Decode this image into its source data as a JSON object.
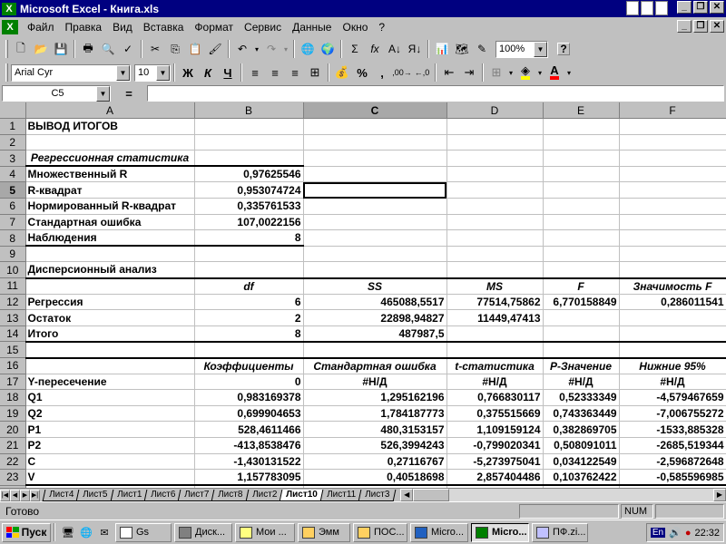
{
  "window": {
    "app_title": "Microsoft Excel - Книга.xls"
  },
  "menu": [
    "Файл",
    "Правка",
    "Вид",
    "Вставка",
    "Формат",
    "Сервис",
    "Данные",
    "Окно",
    "?"
  ],
  "toolbar": {
    "zoom": "100%",
    "font": "Arial Cyr",
    "font_size": "10",
    "bold": "Ж",
    "italic": "К",
    "underline": "Ч",
    "percent": "%",
    "comma": ",",
    "sum": "Σ",
    "fx": "fx",
    "help": "?"
  },
  "formula_bar": {
    "name_box": "C5",
    "equals": "=",
    "content": ""
  },
  "columns": [
    "A",
    "B",
    "C",
    "D",
    "E",
    "F"
  ],
  "rows": [
    {
      "n": "1",
      "a": "ВЫВОД ИТОГОВ",
      "b": "",
      "c": "",
      "d": "",
      "e": "",
      "f": ""
    },
    {
      "n": "2",
      "a": "",
      "b": "",
      "c": "",
      "d": "",
      "e": "",
      "f": ""
    },
    {
      "n": "3",
      "a": "Регрессионная статистика",
      "b": "",
      "c": "",
      "d": "",
      "e": "",
      "f": ""
    },
    {
      "n": "4",
      "a": "Множественный R",
      "b": "0,97625546",
      "c": "",
      "d": "",
      "e": "",
      "f": ""
    },
    {
      "n": "5",
      "a": "R-квадрат",
      "b": "0,953074724",
      "c": "",
      "d": "",
      "e": "",
      "f": ""
    },
    {
      "n": "6",
      "a": "Нормированный R-квадрат",
      "b": "0,335761533",
      "c": "",
      "d": "",
      "e": "",
      "f": ""
    },
    {
      "n": "7",
      "a": "Стандартная ошибка",
      "b": "107,0022156",
      "c": "",
      "d": "",
      "e": "",
      "f": ""
    },
    {
      "n": "8",
      "a": "Наблюдения",
      "b": "8",
      "c": "",
      "d": "",
      "e": "",
      "f": ""
    },
    {
      "n": "9",
      "a": "",
      "b": "",
      "c": "",
      "d": "",
      "e": "",
      "f": ""
    },
    {
      "n": "10",
      "a": "Дисперсионный анализ",
      "b": "",
      "c": "",
      "d": "",
      "e": "",
      "f": ""
    },
    {
      "n": "11",
      "a": "",
      "b": "df",
      "c": "SS",
      "d": "MS",
      "e": "F",
      "f": "Значимость F"
    },
    {
      "n": "12",
      "a": "Регрессия",
      "b": "6",
      "c": "465088,5517",
      "d": "77514,75862",
      "e": "6,770158849",
      "f": "0,286011541"
    },
    {
      "n": "13",
      "a": "Остаток",
      "b": "2",
      "c": "22898,94827",
      "d": "11449,47413",
      "e": "",
      "f": ""
    },
    {
      "n": "14",
      "a": "Итого",
      "b": "8",
      "c": "487987,5",
      "d": "",
      "e": "",
      "f": ""
    },
    {
      "n": "15",
      "a": "",
      "b": "",
      "c": "",
      "d": "",
      "e": "",
      "f": ""
    },
    {
      "n": "16",
      "a": "",
      "b": "Коэффициенты",
      "c": "Стандартная ошибка",
      "d": "t-статистика",
      "e": "P-Значение",
      "f": "Нижние 95%"
    },
    {
      "n": "17",
      "a": "Y-пересечение",
      "b": "0",
      "c": "#Н/Д",
      "d": "#Н/Д",
      "e": "#Н/Д",
      "f": "#Н/Д"
    },
    {
      "n": "18",
      "a": "Q1",
      "b": "0,983169378",
      "c": "1,295162196",
      "d": "0,766830117",
      "e": "0,52333349",
      "f": "-4,579467659"
    },
    {
      "n": "19",
      "a": "Q2",
      "b": "0,699904653",
      "c": "1,784187773",
      "d": "0,375515669",
      "e": "0,743363449",
      "f": "-7,006755272"
    },
    {
      "n": "20",
      "a": "P1",
      "b": "528,4611466",
      "c": "480,3153157",
      "d": "1,109159124",
      "e": "0,382869705",
      "f": "-1533,885328"
    },
    {
      "n": "21",
      "a": "P2",
      "b": "-413,8538476",
      "c": "526,3994243",
      "d": "-0,799020341",
      "e": "0,508091011",
      "f": "-2685,519344"
    },
    {
      "n": "22",
      "a": "C",
      "b": "-1,430131522",
      "c": "0,27116767",
      "d": "-5,273975041",
      "e": "0,034122549",
      "f": "-2,596872648"
    },
    {
      "n": "23",
      "a": "V",
      "b": "1,157783095",
      "c": "0,40518698",
      "d": "2,857404486",
      "e": "0,103762422",
      "f": "-0,585596985"
    },
    {
      "n": "24",
      "a": "",
      "b": "",
      "c": "",
      "d": "",
      "e": "",
      "f": ""
    }
  ],
  "sheet_tabs": [
    "Лист4",
    "Лист5",
    "Лист1",
    "Лист6",
    "Лист7",
    "Лист8",
    "Лист2",
    "Лист10",
    "Лист11",
    "Лист3"
  ],
  "active_sheet": "Лист10",
  "status": {
    "text": "Готово",
    "num": "NUM"
  },
  "taskbar": {
    "start": "Пуск",
    "tasks": [
      "Gs",
      "Диск...",
      "Мои ...",
      "Эмм",
      "ПОС...",
      "Micro...",
      "Micro...",
      "ПФ.zi..."
    ],
    "active_task": "Micro...",
    "lang": "En",
    "clock": "22:32"
  },
  "colors": {
    "title_bg": "#000080",
    "chrome": "#c0c0c0",
    "grid": "#c0c0c0",
    "excel_green": "#008000"
  }
}
